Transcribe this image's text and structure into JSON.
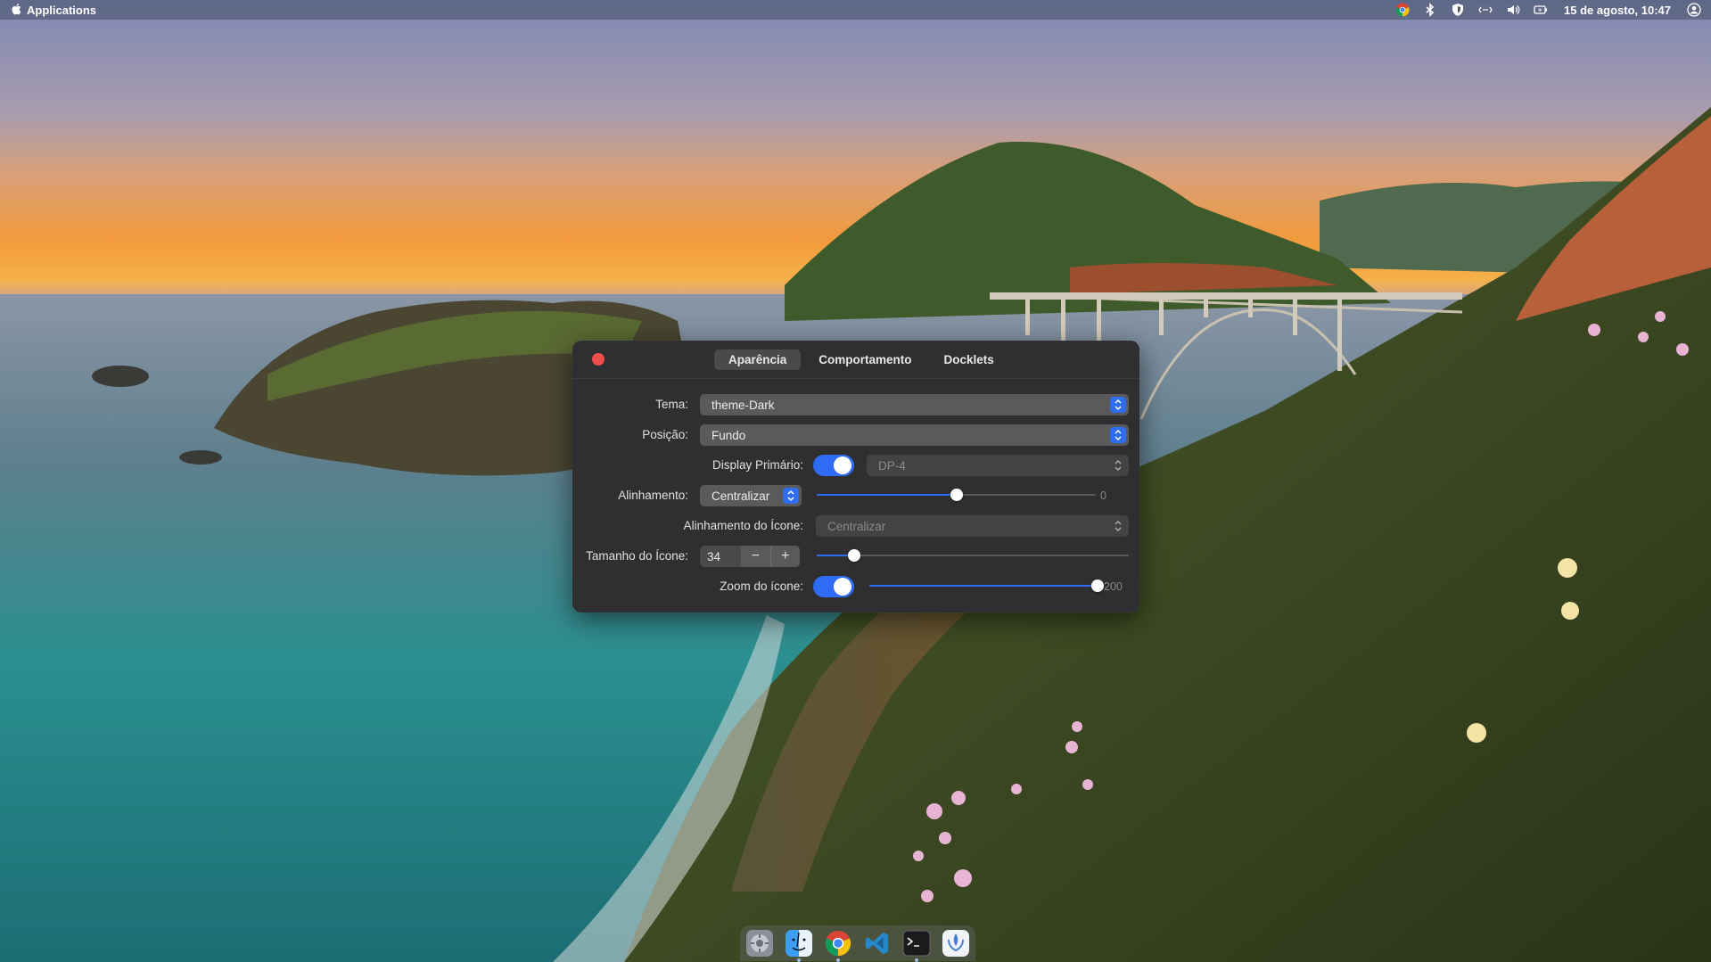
{
  "topbar": {
    "app_name": "Applications",
    "clock": "15 de agosto, 10:47",
    "icons": [
      "apple-icon",
      "chrome-icon",
      "bluetooth-icon",
      "shield-icon",
      "network-icon",
      "volume-icon",
      "battery-icon",
      "user-icon"
    ]
  },
  "dialog": {
    "tabs": [
      "Aparência",
      "Comportamento",
      "Docklets"
    ],
    "active_tab": "Aparência",
    "fields": {
      "theme_label": "Tema:",
      "theme_value": "theme-Dark",
      "position_label": "Posição:",
      "position_value": "Fundo",
      "primary_display_label": "Display Primário:",
      "primary_display_value": "DP-4",
      "primary_display_enabled": true,
      "alignment_label": "Alinhamento:",
      "alignment_value": "Centralizar",
      "alignment_offset": 0.5,
      "alignment_offset_value": "0",
      "icon_alignment_label": "Alinhamento do Ícone:",
      "icon_alignment_value": "Centralizar",
      "icon_size_label": "Tamanho do Ícone:",
      "icon_size_value": "34",
      "icon_size_minus": "−",
      "icon_size_plus": "+",
      "icon_size_slider": 0.12,
      "icon_zoom_label": "Zoom do ícone:",
      "icon_zoom_enabled": true,
      "icon_zoom_slider": 1.0,
      "icon_zoom_value": "200"
    }
  },
  "dock": {
    "items": [
      "settings-icon",
      "finder-icon",
      "chrome-icon",
      "vscode-icon",
      "terminal-icon",
      "fishdock-icon"
    ]
  },
  "colors": {
    "accent": "#2f6bf4",
    "dialog_bg": "#2f2f31",
    "close": "#ef4f4b"
  }
}
